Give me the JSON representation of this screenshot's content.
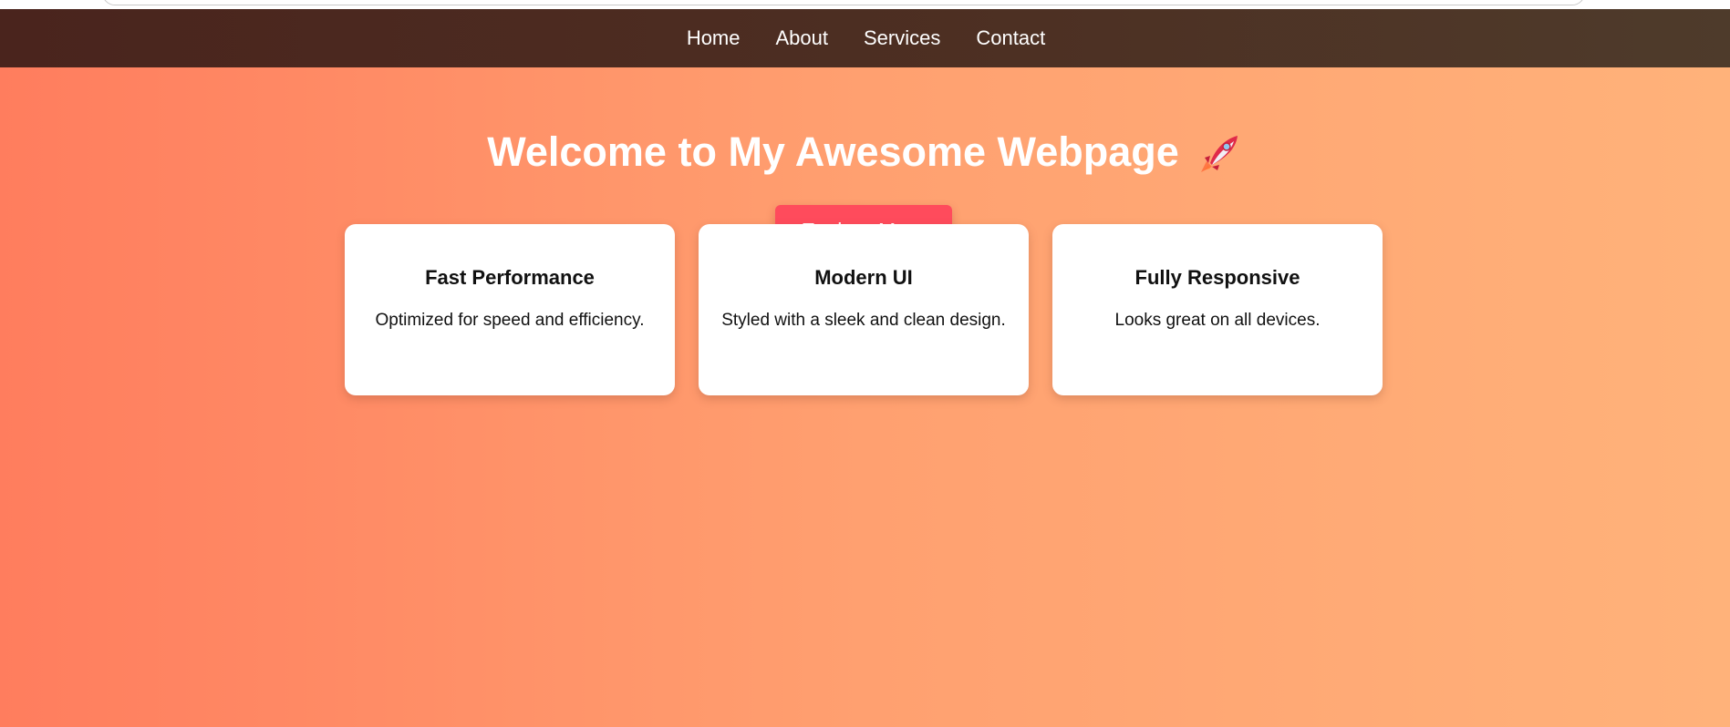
{
  "nav": {
    "items": [
      {
        "label": "Home"
      },
      {
        "label": "About"
      },
      {
        "label": "Services"
      },
      {
        "label": "Contact"
      }
    ]
  },
  "hero": {
    "title": "Welcome to My Awesome Webpage",
    "title_icon": "rocket-icon",
    "button_label": "Explore More"
  },
  "features": [
    {
      "title": "Fast Performance",
      "text": "Optimized for speed and efficiency."
    },
    {
      "title": "Modern UI",
      "text": "Styled with a sleek and clean design."
    },
    {
      "title": "Fully Responsive",
      "text": "Looks great on all devices."
    }
  ],
  "colors": {
    "nav_background": "#4a2a20",
    "gradient_start": "#ff7d5e",
    "gradient_end": "#ffb27a",
    "button": "#ff4b5c",
    "card": "#ffffff"
  }
}
